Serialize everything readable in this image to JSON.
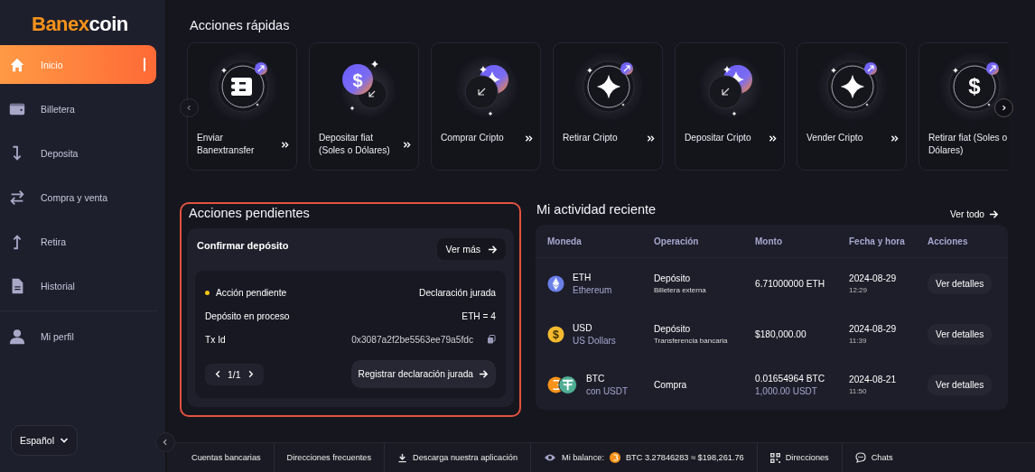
{
  "logo": {
    "part_1": "Banex",
    "part_2": "coin"
  },
  "sidebar": {
    "items": [
      {
        "label": "Inicio",
        "kind": "home",
        "selected": true
      },
      {
        "label": "Billetera",
        "kind": "wallet",
        "selected": false
      },
      {
        "label": "Deposita",
        "kind": "down",
        "selected": false
      },
      {
        "label": "Compra y venta",
        "kind": "swap",
        "selected": false
      },
      {
        "label": "Retira",
        "kind": "up",
        "selected": false
      },
      {
        "label": "Historial",
        "kind": "doc",
        "selected": false
      }
    ],
    "account_items": [
      {
        "label": "Mi perfil",
        "kind": "user",
        "selected": false
      }
    ],
    "language": "Español"
  },
  "quick_actions": {
    "title": "Acciones rápidas",
    "cards": [
      {
        "label": "Enviar Banextransfer",
        "kind": "send"
      },
      {
        "label": "Depositar fiat (Soles o Dólares)",
        "kind": "deposit-fiat",
        "glyph": "$"
      },
      {
        "label": "Comprar Cripto",
        "kind": "buy"
      },
      {
        "label": "Retirar Cripto",
        "kind": "withdraw-crypto"
      },
      {
        "label": "Depositar Cripto",
        "kind": "buy"
      },
      {
        "label": "Vender Cripto",
        "kind": "withdraw-crypto"
      },
      {
        "label": "Retirar fiat (Soles o Dólares)",
        "kind": "withdraw-fiat",
        "glyph": "$"
      }
    ]
  },
  "pending": {
    "title": "Acciones pendientes",
    "card": {
      "title": "Confirmar depósito",
      "more_button": "Ver más",
      "status": "Acción pendiente",
      "status_value": "Declaración jurada",
      "rows": [
        {
          "label": "Depósito en proceso",
          "value": "ETH = 4"
        }
      ],
      "tx": {
        "label": "Tx Id",
        "value": "0x3087a2f2be5563ee79a5fdc"
      },
      "pager": "1/1",
      "register_button": "Registrar declaración jurada"
    }
  },
  "activity": {
    "title": "Mi actividad reciente",
    "view_all": "Ver todo",
    "columns": [
      "Moneda",
      "Operación",
      "Monto",
      "Fecha y hora",
      "Acciones"
    ],
    "rows": [
      {
        "coin": {
          "symbol": "ETH",
          "name": "Ethereum",
          "kind": "eth"
        },
        "operation": "Depósito",
        "operation_detail": "Billetera externa",
        "amount": "6.71000000 ETH",
        "date": "2024-08-29",
        "time": "12:29",
        "action": "Ver detalles"
      },
      {
        "coin": {
          "symbol": "USD",
          "name": "US Dollars",
          "kind": "usd",
          "glyph": "$"
        },
        "operation": "Depósito",
        "operation_detail": "Transferencia bancaria",
        "amount": "$180,000.00",
        "date": "2024-08-29",
        "time": "11:39",
        "action": "Ver detalles"
      },
      {
        "coin": {
          "symbol": "BTC",
          "name": "con USDT",
          "kind": "btc-usdt"
        },
        "operation": "Compra",
        "amount": "0.01654964 BTC",
        "amount_secondary": "1,000.00 USDT",
        "date": "2024-08-21",
        "time": "11:50",
        "action": "Ver detalles"
      }
    ]
  },
  "footer": {
    "links": [
      {
        "label": "Cuentas bancarias",
        "kind": "plain"
      },
      {
        "label": "Direcciones frecuentes",
        "kind": "plain"
      },
      {
        "label": "Descarga nuestra aplicación",
        "kind": "download"
      }
    ],
    "balance": {
      "label": "Mi balance:",
      "value": "BTC 3.27846283 ≈ $198,261.76"
    },
    "tools": [
      {
        "label": "Direcciones",
        "kind": "qr"
      },
      {
        "label": "Chats",
        "kind": "chat"
      }
    ]
  }
}
